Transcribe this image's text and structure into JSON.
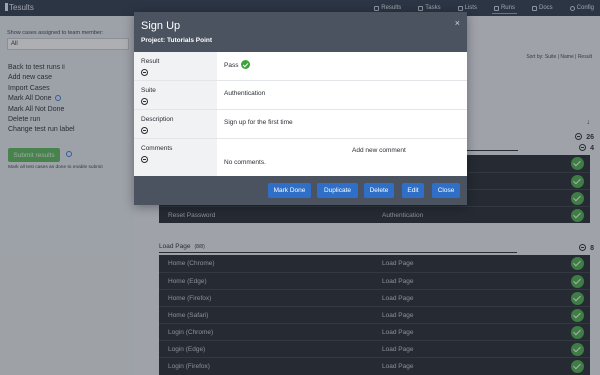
{
  "app": {
    "title": "Tesults"
  },
  "nav": [
    {
      "label": "Results",
      "active": false
    },
    {
      "label": "Tasks",
      "active": false
    },
    {
      "label": "Lists",
      "active": false
    },
    {
      "label": "Runs",
      "active": true
    },
    {
      "label": "Docs",
      "active": false
    },
    {
      "label": "Config",
      "active": false
    }
  ],
  "sidebar": {
    "caption": "Show cases assigned to team member:",
    "select_value": "All",
    "links": [
      "Back to test runs",
      "Add new case",
      "Import Cases",
      "Mark All Done",
      "Mark All Not Done",
      "Delete run",
      "Change test run label"
    ],
    "submit_label": "Submit results",
    "note": "Mark all test cases as done to enable submit"
  },
  "main": {
    "sort_by": "Sort by: Suite | Name | Result",
    "count_total": "26",
    "count_suite": "4",
    "visible_row": {
      "name": "Reset Password",
      "suite": "Authentication"
    },
    "load_page": {
      "title": "Load Page",
      "count_label": "(8/8)",
      "count": "8",
      "rows": [
        {
          "name": "Home (Chrome)",
          "suite": "Load Page"
        },
        {
          "name": "Home (Edge)",
          "suite": "Load Page"
        },
        {
          "name": "Home (Firefox)",
          "suite": "Load Page"
        },
        {
          "name": "Home (Safari)",
          "suite": "Load Page"
        },
        {
          "name": "Login (Chrome)",
          "suite": "Load Page"
        },
        {
          "name": "Login (Edge)",
          "suite": "Load Page"
        },
        {
          "name": "Login (Firefox)",
          "suite": "Load Page"
        }
      ]
    }
  },
  "modal": {
    "title": "Sign Up",
    "subtitle": "Project: Tutorials Point",
    "close": "×",
    "fields": {
      "result_label": "Result",
      "result_value": "Pass",
      "suite_label": "Suite",
      "suite_value": "Authentication",
      "description_label": "Description",
      "description_value": "Sign up for the first time",
      "comments_label": "Comments",
      "comments_value": "No comments.",
      "add_comment": "Add new comment"
    },
    "buttons": {
      "mark_done": "Mark Done",
      "duplicate": "Duplicate",
      "delete": "Delete",
      "edit": "Edit",
      "close": "Close"
    }
  },
  "colors": {
    "accent": "#2f6fc7",
    "pass": "#4cae4c",
    "header": "#4b5360"
  }
}
